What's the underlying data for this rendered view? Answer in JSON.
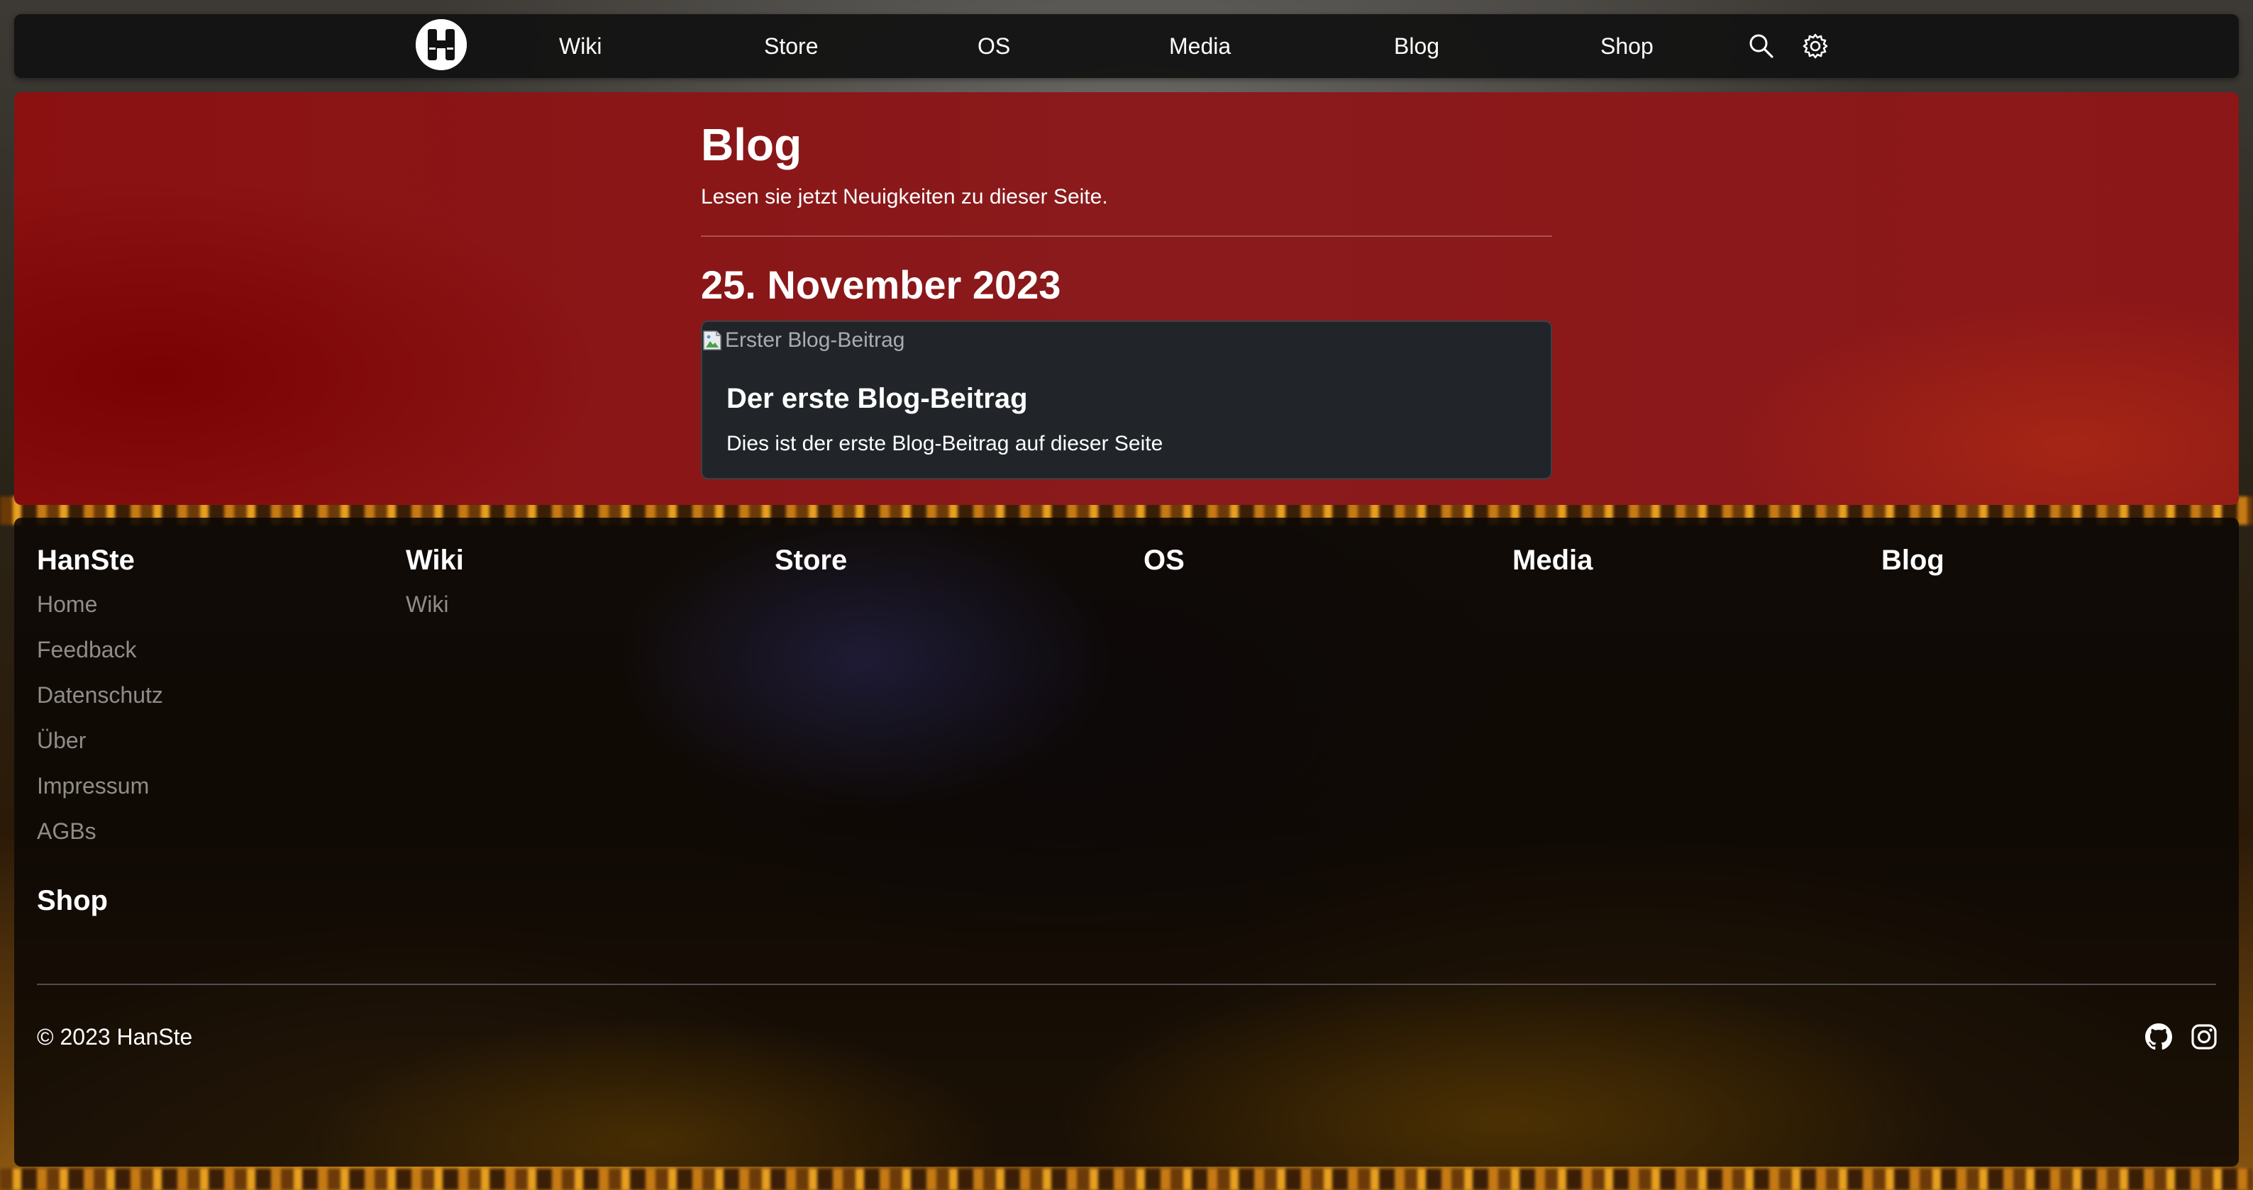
{
  "nav": {
    "logo_icon": "hanste-logo-icon",
    "items": [
      {
        "label": "Wiki"
      },
      {
        "label": "Store"
      },
      {
        "label": "OS"
      },
      {
        "label": "Media"
      },
      {
        "label": "Blog"
      },
      {
        "label": "Shop"
      }
    ],
    "search_icon": "search-icon",
    "settings_icon": "gear-icon"
  },
  "hero": {
    "title": "Blog",
    "subtitle": "Lesen sie jetzt Neuigkeiten zu dieser Seite.",
    "accent": "#8b1a1a"
  },
  "posts": {
    "date": "25. November 2023",
    "items": [
      {
        "image_alt": "Erster Blog-Beitrag",
        "title": "Der erste Blog-Beitrag",
        "summary": "Dies ist der erste Blog-Beitrag auf dieser Seite"
      }
    ]
  },
  "footer": {
    "columns": [
      {
        "heading": "HanSte",
        "links": [
          "Home",
          "Feedback",
          "Datenschutz",
          "Über",
          "Impressum",
          "AGBs"
        ]
      },
      {
        "heading": "Wiki",
        "links": [
          "Wiki"
        ]
      },
      {
        "heading": "Store",
        "links": []
      },
      {
        "heading": "OS",
        "links": []
      },
      {
        "heading": "Media",
        "links": []
      },
      {
        "heading": "Blog",
        "links": []
      },
      {
        "heading": "Shop",
        "links": []
      }
    ],
    "copyright": "© 2023 HanSte",
    "social": [
      "github-icon",
      "instagram-icon"
    ],
    "link_color": "#8f8d89"
  }
}
